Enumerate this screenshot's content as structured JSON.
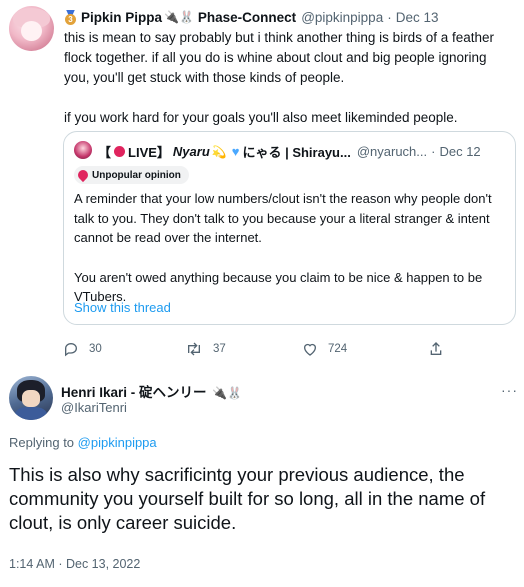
{
  "tweet1": {
    "display_name": "Pipkin Pippa",
    "name_badges": "🔌🐰",
    "affiliation": "Phase-Connect",
    "handle": "@pipkinpippa",
    "separator": "·",
    "date": "Dec 13",
    "body_paragraphs": [
      "this is mean to say probably but i think another thing is birds of a feather flock together. if all you do is whine about clout and big people ignoring you, you'll get stuck with those kinds of people.",
      "if you work hard for your goals you'll also meet likeminded people."
    ],
    "quote": {
      "name_prefix": "【",
      "live_label": "LIVE】",
      "name_main": "Nyaru",
      "name_emoji": "💫",
      "name_suffix": "にゃる | Shirayu...",
      "handle": "@nyaruch...",
      "separator": "·",
      "date": "Dec 12",
      "badge_label": "Unpopular opinion",
      "body_paragraphs": [
        "A reminder that your low numbers/clout isn't the reason why people don't talk to you. They don't talk to you because your a literal stranger & intent cannot be read over the internet.",
        "You aren't owed anything because you claim to be nice & happen to be VTubers."
      ],
      "show_thread": "Show this thread"
    },
    "actions": {
      "replies": "30",
      "retweets": "37",
      "likes": "724"
    }
  },
  "tweet2": {
    "display_name": "Henri Ikari - 碇ヘンリー",
    "name_badges": "🔌🐰",
    "handle": "@IkariTenri",
    "more": "···",
    "replying_prefix": "Replying to",
    "replying_handle": "@pipkinpippa",
    "body": "This is also why sacrificintg your previous audience, the community you yourself built for so long, all in the name of clout, is only career suicide.",
    "timestamp": "1:14 AM · Dec 13, 2022"
  },
  "colors": {
    "link": "#1d9bf0",
    "muted": "#536471",
    "text": "#0f1419",
    "border": "#cfd9de"
  },
  "icons": [
    "medal-icon",
    "reply-icon",
    "retweet-icon",
    "like-icon",
    "share-icon",
    "more-icon"
  ]
}
